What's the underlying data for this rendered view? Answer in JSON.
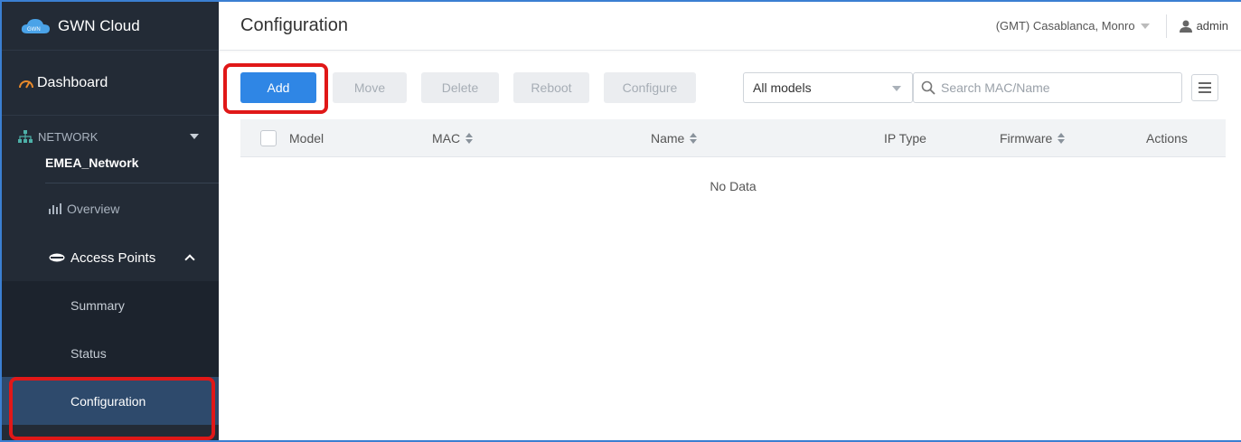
{
  "app": {
    "name": "GWN Cloud"
  },
  "sidebar": {
    "dashboard_label": "Dashboard",
    "section_label": "NETWORK",
    "network_name": "EMEA_Network",
    "overview_label": "Overview",
    "access_points_label": "Access Points",
    "sub_items": [
      {
        "label": "Summary"
      },
      {
        "label": "Status"
      },
      {
        "label": "Configuration"
      }
    ]
  },
  "header": {
    "title": "Configuration",
    "timezone": "(GMT) Casablanca, Monro",
    "user": "admin"
  },
  "toolbar": {
    "add_label": "Add",
    "move_label": "Move",
    "delete_label": "Delete",
    "reboot_label": "Reboot",
    "configure_label": "Configure",
    "model_filter": "All models",
    "search_placeholder": "Search MAC/Name"
  },
  "table": {
    "columns": [
      "Model",
      "MAC",
      "Name",
      "IP Type",
      "Firmware",
      "Actions"
    ],
    "empty_text": "No Data"
  },
  "colors": {
    "sidebar_bg": "#232b36",
    "active_item_bg": "#2e4a6c",
    "primary": "#2f86e5",
    "highlight": "#e01818"
  }
}
